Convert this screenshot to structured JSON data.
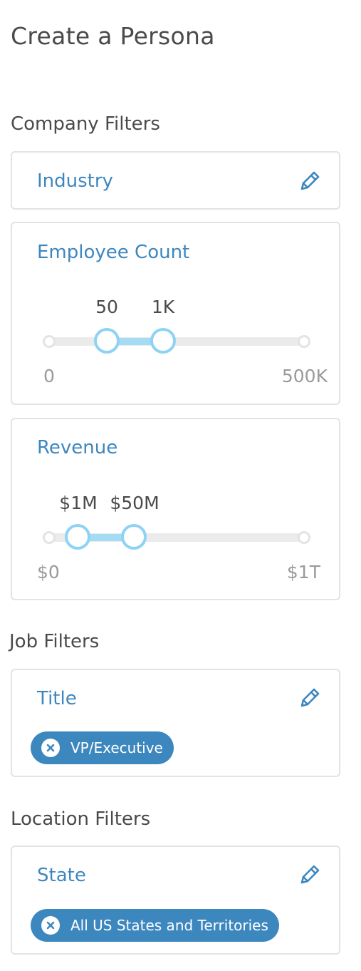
{
  "page": {
    "title": "Create a Persona"
  },
  "colors": {
    "accent": "#3d87bf",
    "slider_fill": "#a5dcf5",
    "slider_handle": "#8fd3f4"
  },
  "company_filters": {
    "title": "Company Filters",
    "industry": {
      "label": "Industry",
      "edit_icon": "pencil-icon"
    },
    "employee_count": {
      "label": "Employee Count",
      "selected_min": "50",
      "selected_max": "1K",
      "scale_min": "0",
      "scale_max": "500K",
      "selected_range_fraction": [
        0.23,
        0.45
      ]
    },
    "revenue": {
      "label": "Revenue",
      "selected_min": "$1M",
      "selected_max": "$50M",
      "scale_min": "$0",
      "scale_max": "$1T",
      "selected_range_fraction": [
        0.11,
        0.33
      ]
    }
  },
  "job_filters": {
    "title": "Job Filters",
    "job_title": {
      "label": "Title",
      "edit_icon": "pencil-icon",
      "chips": [
        "VP/Executive"
      ]
    }
  },
  "location_filters": {
    "title": "Location Filters",
    "state": {
      "label": "State",
      "edit_icon": "pencil-icon",
      "chips": [
        "All US States and Territories"
      ]
    }
  }
}
